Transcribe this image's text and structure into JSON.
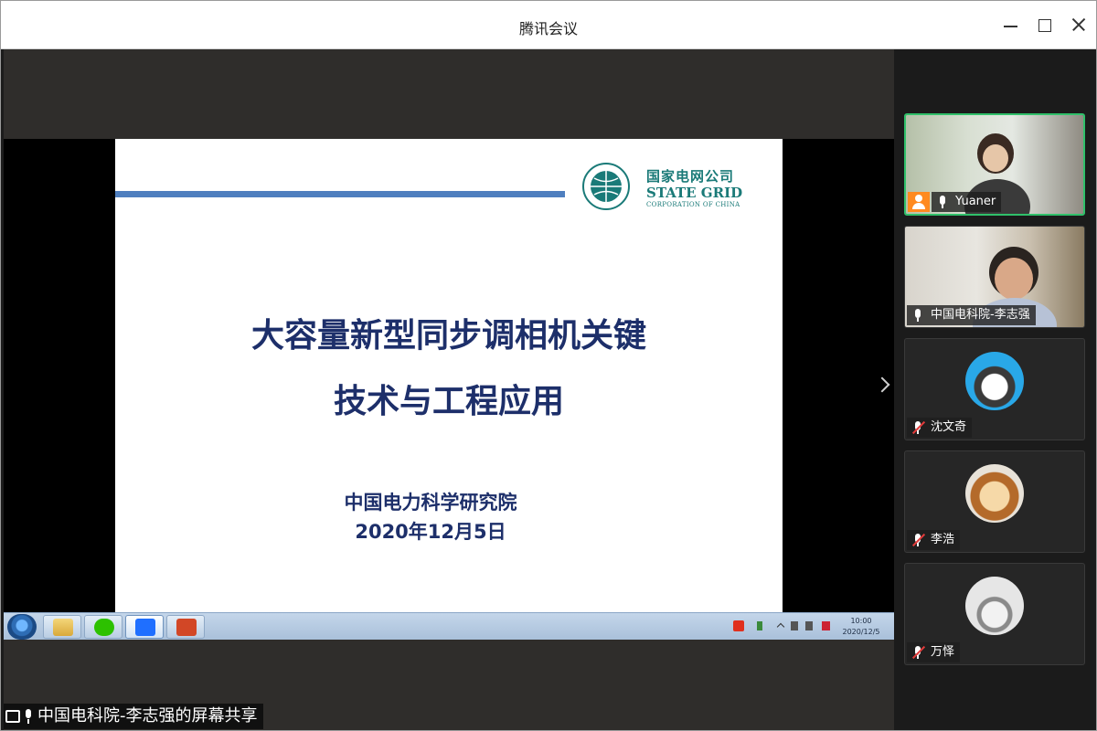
{
  "window": {
    "title": "腾讯会议"
  },
  "slide": {
    "logo_cn": "国家电网公司",
    "logo_en": "STATE GRID",
    "logo_en_sub": "CORPORATION OF CHINA",
    "title_line1": "大容量新型同步调相机关键",
    "title_line2": "技术与工程应用",
    "organization": "中国电力科学研究院",
    "date": "2020年12月5日"
  },
  "taskbar": {
    "clock_time": "10:00",
    "clock_date": "2020/12/5"
  },
  "share_status": {
    "text": "中国电科院-李志强的屏幕共享"
  },
  "participants": [
    {
      "name": "Yuaner",
      "muted": false,
      "host": true,
      "video": true
    },
    {
      "name": "中国电科院-李志强",
      "muted": false,
      "host": false,
      "video": true
    },
    {
      "name": "沈文奇",
      "muted": true,
      "host": false,
      "video": false
    },
    {
      "name": "李浩",
      "muted": true,
      "host": false,
      "video": false
    },
    {
      "name": "万怿",
      "muted": true,
      "host": false,
      "video": false
    }
  ],
  "colors": {
    "speaking_border": "#30c06a",
    "slide_title": "#1d2f6a",
    "state_grid_green": "#1a7a78"
  }
}
